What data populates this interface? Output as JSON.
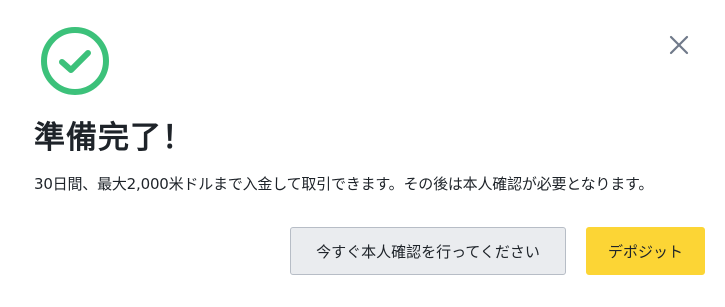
{
  "dialog": {
    "title": "準備完了！",
    "message": "30日間、最大2,000米ドルまで入金して取引できます。その後は本人確認が必要となります。",
    "buttons": {
      "verify_now_label": "今すぐ本人確認を行ってください",
      "deposit_label": "デポジット"
    },
    "icons": {
      "success": "check-circle-icon",
      "close": "close-icon"
    },
    "colors": {
      "success_green": "#3cc17a",
      "primary_yellow": "#fcd535",
      "secondary_gray": "#eaecef",
      "text": "#1e2329"
    }
  }
}
